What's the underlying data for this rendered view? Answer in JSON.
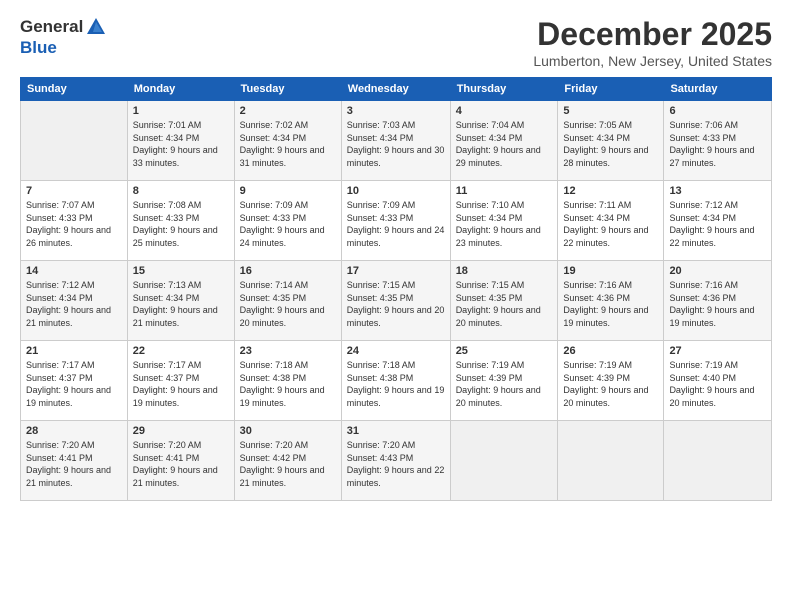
{
  "header": {
    "logo_general": "General",
    "logo_blue": "Blue",
    "month_title": "December 2025",
    "location": "Lumberton, New Jersey, United States"
  },
  "weekdays": [
    "Sunday",
    "Monday",
    "Tuesday",
    "Wednesday",
    "Thursday",
    "Friday",
    "Saturday"
  ],
  "weeks": [
    [
      {
        "day": "",
        "sunrise": "",
        "sunset": "",
        "daylight": ""
      },
      {
        "day": "1",
        "sunrise": "Sunrise: 7:01 AM",
        "sunset": "Sunset: 4:34 PM",
        "daylight": "Daylight: 9 hours and 33 minutes."
      },
      {
        "day": "2",
        "sunrise": "Sunrise: 7:02 AM",
        "sunset": "Sunset: 4:34 PM",
        "daylight": "Daylight: 9 hours and 31 minutes."
      },
      {
        "day": "3",
        "sunrise": "Sunrise: 7:03 AM",
        "sunset": "Sunset: 4:34 PM",
        "daylight": "Daylight: 9 hours and 30 minutes."
      },
      {
        "day": "4",
        "sunrise": "Sunrise: 7:04 AM",
        "sunset": "Sunset: 4:34 PM",
        "daylight": "Daylight: 9 hours and 29 minutes."
      },
      {
        "day": "5",
        "sunrise": "Sunrise: 7:05 AM",
        "sunset": "Sunset: 4:34 PM",
        "daylight": "Daylight: 9 hours and 28 minutes."
      },
      {
        "day": "6",
        "sunrise": "Sunrise: 7:06 AM",
        "sunset": "Sunset: 4:33 PM",
        "daylight": "Daylight: 9 hours and 27 minutes."
      }
    ],
    [
      {
        "day": "7",
        "sunrise": "Sunrise: 7:07 AM",
        "sunset": "Sunset: 4:33 PM",
        "daylight": "Daylight: 9 hours and 26 minutes."
      },
      {
        "day": "8",
        "sunrise": "Sunrise: 7:08 AM",
        "sunset": "Sunset: 4:33 PM",
        "daylight": "Daylight: 9 hours and 25 minutes."
      },
      {
        "day": "9",
        "sunrise": "Sunrise: 7:09 AM",
        "sunset": "Sunset: 4:33 PM",
        "daylight": "Daylight: 9 hours and 24 minutes."
      },
      {
        "day": "10",
        "sunrise": "Sunrise: 7:09 AM",
        "sunset": "Sunset: 4:33 PM",
        "daylight": "Daylight: 9 hours and 24 minutes."
      },
      {
        "day": "11",
        "sunrise": "Sunrise: 7:10 AM",
        "sunset": "Sunset: 4:34 PM",
        "daylight": "Daylight: 9 hours and 23 minutes."
      },
      {
        "day": "12",
        "sunrise": "Sunrise: 7:11 AM",
        "sunset": "Sunset: 4:34 PM",
        "daylight": "Daylight: 9 hours and 22 minutes."
      },
      {
        "day": "13",
        "sunrise": "Sunrise: 7:12 AM",
        "sunset": "Sunset: 4:34 PM",
        "daylight": "Daylight: 9 hours and 22 minutes."
      }
    ],
    [
      {
        "day": "14",
        "sunrise": "Sunrise: 7:12 AM",
        "sunset": "Sunset: 4:34 PM",
        "daylight": "Daylight: 9 hours and 21 minutes."
      },
      {
        "day": "15",
        "sunrise": "Sunrise: 7:13 AM",
        "sunset": "Sunset: 4:34 PM",
        "daylight": "Daylight: 9 hours and 21 minutes."
      },
      {
        "day": "16",
        "sunrise": "Sunrise: 7:14 AM",
        "sunset": "Sunset: 4:35 PM",
        "daylight": "Daylight: 9 hours and 20 minutes."
      },
      {
        "day": "17",
        "sunrise": "Sunrise: 7:15 AM",
        "sunset": "Sunset: 4:35 PM",
        "daylight": "Daylight: 9 hours and 20 minutes."
      },
      {
        "day": "18",
        "sunrise": "Sunrise: 7:15 AM",
        "sunset": "Sunset: 4:35 PM",
        "daylight": "Daylight: 9 hours and 20 minutes."
      },
      {
        "day": "19",
        "sunrise": "Sunrise: 7:16 AM",
        "sunset": "Sunset: 4:36 PM",
        "daylight": "Daylight: 9 hours and 19 minutes."
      },
      {
        "day": "20",
        "sunrise": "Sunrise: 7:16 AM",
        "sunset": "Sunset: 4:36 PM",
        "daylight": "Daylight: 9 hours and 19 minutes."
      }
    ],
    [
      {
        "day": "21",
        "sunrise": "Sunrise: 7:17 AM",
        "sunset": "Sunset: 4:37 PM",
        "daylight": "Daylight: 9 hours and 19 minutes."
      },
      {
        "day": "22",
        "sunrise": "Sunrise: 7:17 AM",
        "sunset": "Sunset: 4:37 PM",
        "daylight": "Daylight: 9 hours and 19 minutes."
      },
      {
        "day": "23",
        "sunrise": "Sunrise: 7:18 AM",
        "sunset": "Sunset: 4:38 PM",
        "daylight": "Daylight: 9 hours and 19 minutes."
      },
      {
        "day": "24",
        "sunrise": "Sunrise: 7:18 AM",
        "sunset": "Sunset: 4:38 PM",
        "daylight": "Daylight: 9 hours and 19 minutes."
      },
      {
        "day": "25",
        "sunrise": "Sunrise: 7:19 AM",
        "sunset": "Sunset: 4:39 PM",
        "daylight": "Daylight: 9 hours and 20 minutes."
      },
      {
        "day": "26",
        "sunrise": "Sunrise: 7:19 AM",
        "sunset": "Sunset: 4:39 PM",
        "daylight": "Daylight: 9 hours and 20 minutes."
      },
      {
        "day": "27",
        "sunrise": "Sunrise: 7:19 AM",
        "sunset": "Sunset: 4:40 PM",
        "daylight": "Daylight: 9 hours and 20 minutes."
      }
    ],
    [
      {
        "day": "28",
        "sunrise": "Sunrise: 7:20 AM",
        "sunset": "Sunset: 4:41 PM",
        "daylight": "Daylight: 9 hours and 21 minutes."
      },
      {
        "day": "29",
        "sunrise": "Sunrise: 7:20 AM",
        "sunset": "Sunset: 4:41 PM",
        "daylight": "Daylight: 9 hours and 21 minutes."
      },
      {
        "day": "30",
        "sunrise": "Sunrise: 7:20 AM",
        "sunset": "Sunset: 4:42 PM",
        "daylight": "Daylight: 9 hours and 21 minutes."
      },
      {
        "day": "31",
        "sunrise": "Sunrise: 7:20 AM",
        "sunset": "Sunset: 4:43 PM",
        "daylight": "Daylight: 9 hours and 22 minutes."
      },
      {
        "day": "",
        "sunrise": "",
        "sunset": "",
        "daylight": ""
      },
      {
        "day": "",
        "sunrise": "",
        "sunset": "",
        "daylight": ""
      },
      {
        "day": "",
        "sunrise": "",
        "sunset": "",
        "daylight": ""
      }
    ]
  ]
}
